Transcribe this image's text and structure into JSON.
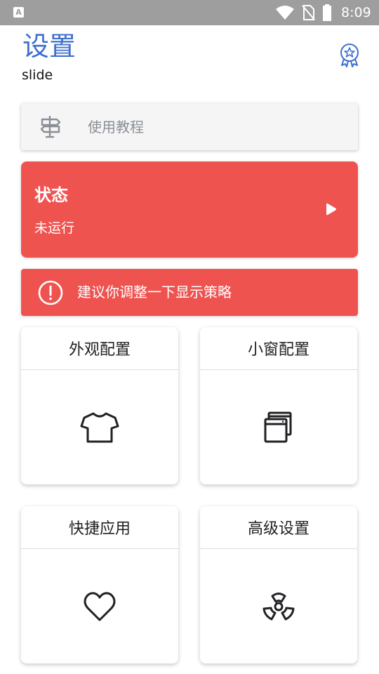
{
  "status_bar": {
    "app_indicator": "A",
    "time": "8:09",
    "icons": [
      "wifi-icon",
      "no-sim-icon",
      "battery-icon"
    ]
  },
  "header": {
    "title": "设置",
    "subtitle": "slide",
    "badge_icon": "award-icon"
  },
  "tutorial": {
    "label": "使用教程",
    "icon": "signpost-icon"
  },
  "status_card": {
    "title": "状态",
    "value": "未运行",
    "action_icon": "play-icon",
    "color": "#ef5350"
  },
  "warning": {
    "text": "建议你调整一下显示策略",
    "icon": "alert-circle-icon",
    "color": "#ef5350"
  },
  "tiles": [
    {
      "label": "外观配置",
      "icon": "tshirt-icon"
    },
    {
      "label": "小窗配置",
      "icon": "windows-icon"
    },
    {
      "label": "快捷应用",
      "icon": "heart-icon"
    },
    {
      "label": "高级设置",
      "icon": "radiation-icon"
    }
  ],
  "colors": {
    "accent": "#3f6fcf",
    "status_bar": "#9e9e9e"
  }
}
